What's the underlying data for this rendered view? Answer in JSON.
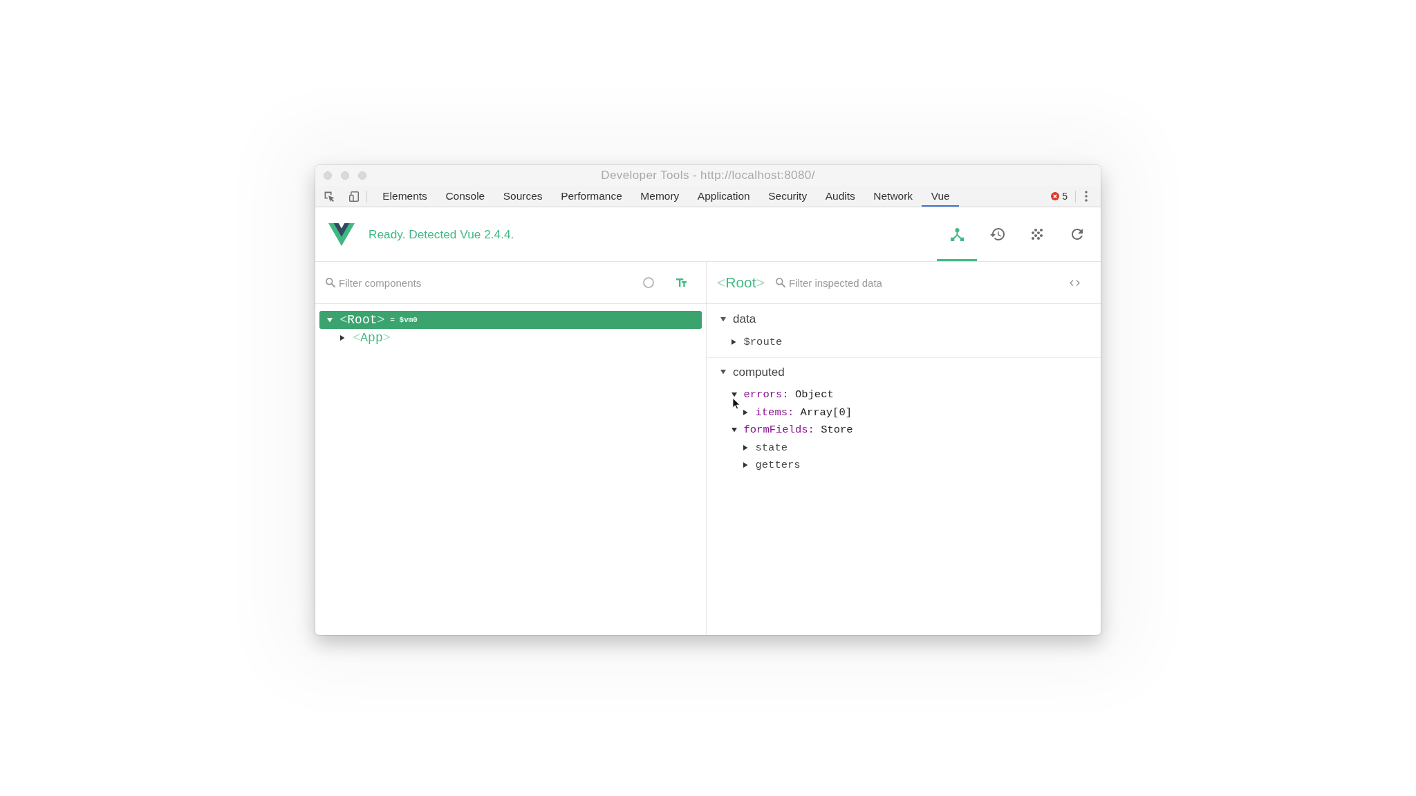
{
  "window": {
    "title": "Developer Tools - http://localhost:8080/"
  },
  "toolbar": {
    "tabs": [
      {
        "label": "Elements",
        "selected": false
      },
      {
        "label": "Console",
        "selected": false
      },
      {
        "label": "Sources",
        "selected": false
      },
      {
        "label": "Performance",
        "selected": false
      },
      {
        "label": "Memory",
        "selected": false
      },
      {
        "label": "Application",
        "selected": false
      },
      {
        "label": "Security",
        "selected": false
      },
      {
        "label": "Audits",
        "selected": false
      },
      {
        "label": "Network",
        "selected": false
      },
      {
        "label": "Vue",
        "selected": true
      }
    ],
    "error_count": "5"
  },
  "vue_header": {
    "status": "Ready. Detected Vue 2.4.4.",
    "tools": [
      {
        "kind": "components",
        "selected": true
      },
      {
        "kind": "history",
        "selected": false
      },
      {
        "kind": "events",
        "selected": false
      },
      {
        "kind": "refresh",
        "selected": false
      }
    ]
  },
  "components_pane": {
    "filter": {
      "placeholder": "Filter components"
    },
    "toggles": [
      {
        "kind": "select",
        "on": false
      },
      {
        "kind": "format",
        "on": true
      }
    ],
    "tree": [
      {
        "name": "<Root>",
        "instance": "= $vm0",
        "selected": true,
        "expanded": true,
        "children": [
          {
            "name": "<App>",
            "selected": false,
            "expanded": false
          }
        ]
      }
    ]
  },
  "inspector": {
    "title": "<Root>",
    "filter": {
      "placeholder": "Filter inspected data"
    },
    "sections": [
      {
        "name": "data",
        "expanded": true,
        "items": [
          {
            "key": "$route",
            "kind": "abstract",
            "expanded": false
          }
        ]
      },
      {
        "name": "computed",
        "expanded": true,
        "items": [
          {
            "key": "errors:",
            "value": "Object",
            "kind": "property",
            "expanded": true,
            "children": [
              {
                "key": "items:",
                "value": "Array[0]",
                "kind": "property",
                "expanded": false
              }
            ]
          },
          {
            "key": "formFields:",
            "value": "Store",
            "kind": "property",
            "expanded": true,
            "children": [
              {
                "key": "state",
                "kind": "abstract",
                "expanded": false
              },
              {
                "key": "getters",
                "kind": "abstract",
                "expanded": false
              }
            ]
          }
        ]
      }
    ]
  }
}
